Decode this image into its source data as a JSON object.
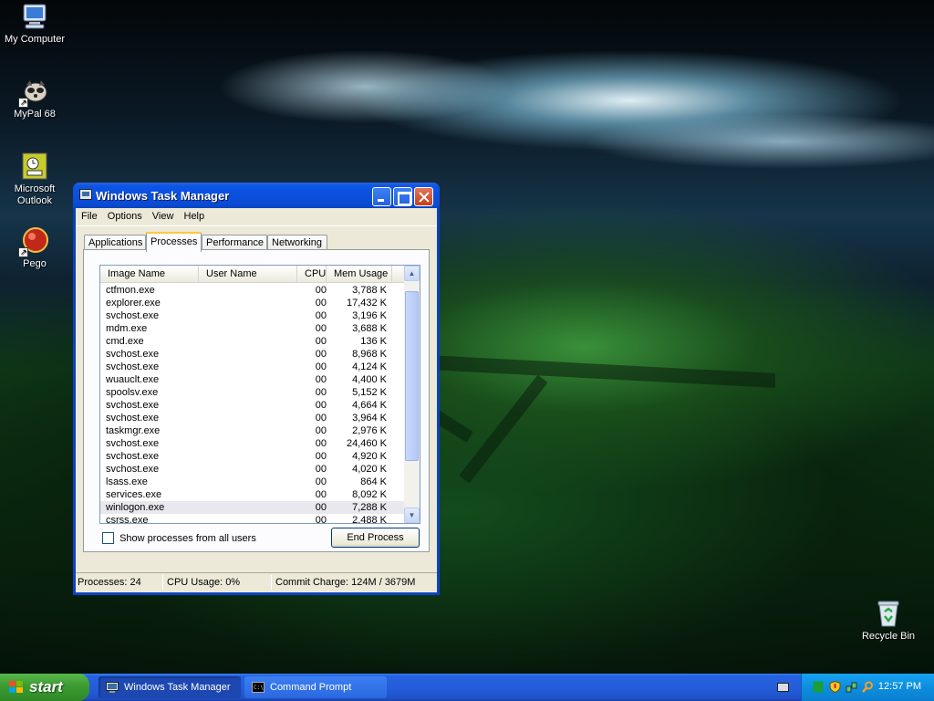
{
  "desktop": {
    "icons": [
      {
        "label": "My Computer",
        "icon": "my-computer-icon"
      },
      {
        "label": "MyPal 68",
        "icon": "mypal-icon"
      },
      {
        "label": "Microsoft Outlook",
        "icon": "outlook-icon"
      },
      {
        "label": "Pego",
        "icon": "pego-icon"
      },
      {
        "label": "Recycle Bin",
        "icon": "recycle-bin-icon"
      }
    ]
  },
  "window": {
    "title": "Windows Task Manager",
    "menu": [
      "File",
      "Options",
      "View",
      "Help"
    ],
    "tabs": [
      "Applications",
      "Processes",
      "Performance",
      "Networking"
    ],
    "active_tab": "Processes",
    "columns": [
      "Image Name",
      "User Name",
      "CPU",
      "Mem Usage"
    ],
    "processes": [
      {
        "name": "ctfmon.exe",
        "user": "",
        "cpu": "00",
        "mem": "3,788 K"
      },
      {
        "name": "explorer.exe",
        "user": "",
        "cpu": "00",
        "mem": "17,432 K"
      },
      {
        "name": "svchost.exe",
        "user": "",
        "cpu": "00",
        "mem": "3,196 K"
      },
      {
        "name": "mdm.exe",
        "user": "",
        "cpu": "00",
        "mem": "3,688 K"
      },
      {
        "name": "cmd.exe",
        "user": "",
        "cpu": "00",
        "mem": "136 K"
      },
      {
        "name": "svchost.exe",
        "user": "",
        "cpu": "00",
        "mem": "8,968 K"
      },
      {
        "name": "svchost.exe",
        "user": "",
        "cpu": "00",
        "mem": "4,124 K"
      },
      {
        "name": "wuauclt.exe",
        "user": "",
        "cpu": "00",
        "mem": "4,400 K"
      },
      {
        "name": "spoolsv.exe",
        "user": "",
        "cpu": "00",
        "mem": "5,152 K"
      },
      {
        "name": "svchost.exe",
        "user": "",
        "cpu": "00",
        "mem": "4,664 K"
      },
      {
        "name": "svchost.exe",
        "user": "",
        "cpu": "00",
        "mem": "3,964 K"
      },
      {
        "name": "taskmgr.exe",
        "user": "",
        "cpu": "00",
        "mem": "2,976 K"
      },
      {
        "name": "svchost.exe",
        "user": "",
        "cpu": "00",
        "mem": "24,460 K"
      },
      {
        "name": "svchost.exe",
        "user": "",
        "cpu": "00",
        "mem": "4,920 K"
      },
      {
        "name": "svchost.exe",
        "user": "",
        "cpu": "00",
        "mem": "4,020 K"
      },
      {
        "name": "lsass.exe",
        "user": "",
        "cpu": "00",
        "mem": "864 K"
      },
      {
        "name": "services.exe",
        "user": "",
        "cpu": "00",
        "mem": "8,092 K"
      },
      {
        "name": "winlogon.exe",
        "user": "",
        "cpu": "00",
        "mem": "7,288 K",
        "selected": true
      },
      {
        "name": "csrss.exe",
        "user": "",
        "cpu": "00",
        "mem": "2,488 K"
      }
    ],
    "show_all_label": "Show processes from all users",
    "show_all_checked": false,
    "end_process_label": "End Process",
    "status": {
      "processes": "Processes: 24",
      "cpu": "CPU Usage: 0%",
      "commit": "Commit Charge: 124M / 3679M"
    }
  },
  "taskbar": {
    "start_label": "start",
    "tasks": [
      {
        "label": "Windows Task Manager",
        "icon": "task-manager-icon",
        "active": true
      },
      {
        "label": "Command Prompt",
        "icon": "command-prompt-icon",
        "active": false
      }
    ],
    "tray_icons": [
      "network-icon",
      "security-shield-icon",
      "wireless-icon",
      "search-icon"
    ],
    "clock": "12:57 PM"
  },
  "colors": {
    "titlebar": "#0a4bd4",
    "start_button": "#3c9a33",
    "taskbar": "#245dda",
    "window_face": "#ece9d8",
    "active_tab_accent": "#ffc83c"
  }
}
